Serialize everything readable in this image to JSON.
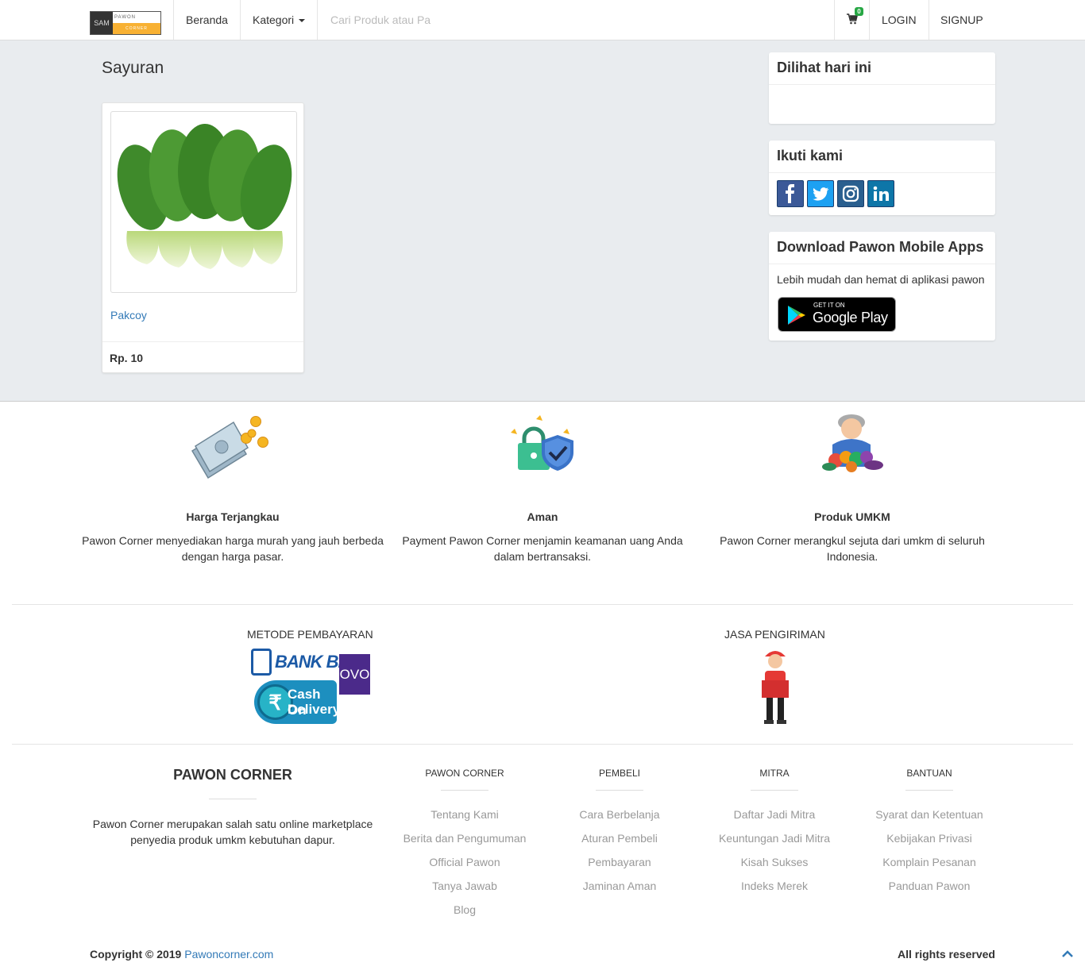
{
  "nav": {
    "logo_left": "SAM",
    "logo_top": "PAWON",
    "logo_bottom": "CORNER",
    "home": "Beranda",
    "category": "Kategori",
    "search_placeholder": "Cari Produk atau Pa",
    "cart_count": "0",
    "login": "LOGIN",
    "signup": "SIGNUP"
  },
  "main": {
    "title": "Sayuran",
    "products": [
      {
        "name": "Pakcoy",
        "price": "Rp. 10"
      }
    ]
  },
  "sidebar": {
    "viewed_title": "Dilihat hari ini",
    "follow_title": "Ikuti kami",
    "social": [
      "facebook-icon",
      "twitter-icon",
      "instagram-icon",
      "linkedin-icon"
    ],
    "download_title": "Download Pawon Mobile Apps",
    "download_text": "Lebih mudah dan hemat di aplikasi pawon",
    "badge_small": "GET IT ON",
    "badge_big": "Google Play"
  },
  "features": [
    {
      "title": "Harga Terjangkau",
      "text": "Pawon Corner menyediakan harga murah yang jauh berbeda dengan harga pasar."
    },
    {
      "title": "Aman",
      "text": "Payment Pawon Corner menjamin keamanan uang Anda dalam bertransaksi."
    },
    {
      "title": "Produk UMKM",
      "text": "Pawon Corner merangkul sejuta dari umkm di seluruh Indonesia."
    }
  ],
  "payment": {
    "label": "METODE PEMBAYARAN",
    "bri": "BANK BRI",
    "ovo": "OVO",
    "cod_1": "Cash On",
    "cod_2": "Delivery"
  },
  "shipping": {
    "label": "JASA PENGIRIMAN"
  },
  "footer": {
    "brand": "PAWON CORNER",
    "about": "Pawon Corner merupakan salah satu online marketplace penyedia produk umkm kebutuhan dapur.",
    "columns": [
      {
        "title": "PAWON CORNER",
        "links": [
          "Tentang Kami",
          "Berita dan Pengumuman",
          "Official Pawon",
          "Tanya Jawab",
          "Blog"
        ]
      },
      {
        "title": "PEMBELI",
        "links": [
          "Cara Berbelanja",
          "Aturan Pembeli",
          "Pembayaran",
          "Jaminan Aman"
        ]
      },
      {
        "title": "MITRA",
        "links": [
          "Daftar Jadi Mitra",
          "Keuntungan Jadi Mitra",
          "Kisah Sukses",
          "Indeks Merek"
        ]
      },
      {
        "title": "BANTUAN",
        "links": [
          "Syarat dan Ketentuan",
          "Kebijakan Privasi",
          "Komplain Pesanan",
          "Panduan Pawon"
        ]
      }
    ],
    "copyright": "Copyright © 2019",
    "site": "Pawoncorner.com",
    "rights": "All rights reserved"
  },
  "colors": {
    "accent": "#337ab7",
    "bg": "#e9ecef",
    "badge": "#27a744"
  }
}
